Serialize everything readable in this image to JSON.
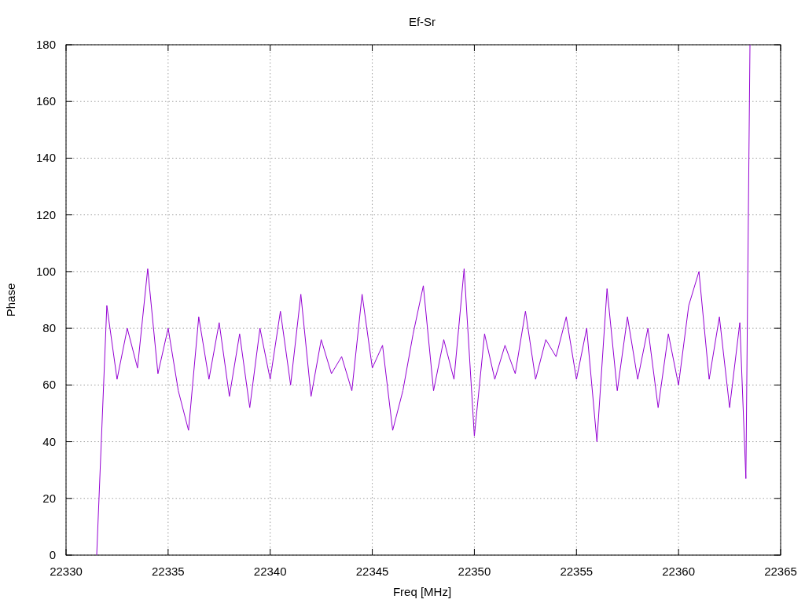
{
  "chart": {
    "chart_data": {
      "type": "line",
      "title": "Ef-Sr",
      "xlabel": "Freq [MHz]",
      "ylabel": "Phase",
      "x": [
        22331.5,
        22332,
        22332.5,
        22333,
        22333.5,
        22334,
        22334.5,
        22335,
        22335.5,
        22336,
        22336.5,
        22337,
        22337.5,
        22338,
        22338.5,
        22339,
        22339.5,
        22340,
        22340.5,
        22341,
        22341.5,
        22342,
        22342.5,
        22343,
        22343.5,
        22344,
        22344.5,
        22345,
        22345.5,
        22346,
        22346.5,
        22347,
        22347.5,
        22348,
        22348.5,
        22349,
        22349.5,
        22350,
        22350.5,
        22351,
        22351.5,
        22352,
        22352.5,
        22353,
        22353.5,
        22354,
        22354.5,
        22355,
        22355.5,
        22356,
        22356.5,
        22357,
        22357.5,
        22358,
        22358.5,
        22359,
        22359.5,
        22360,
        22360.5,
        22361,
        22361.5,
        22362,
        22362.5,
        22363,
        22363.3,
        22363.5
      ],
      "series": [
        {
          "color": "#9400d3",
          "values": [
            0,
            88,
            62,
            80,
            66,
            101,
            64,
            80,
            58,
            44,
            84,
            62,
            82,
            56,
            78,
            52,
            80,
            62,
            86,
            60,
            92,
            56,
            76,
            64,
            70,
            58,
            92,
            66,
            74,
            44,
            58,
            78,
            95,
            58,
            76,
            62,
            101,
            42,
            78,
            62,
            74,
            64,
            86,
            62,
            76,
            70,
            84,
            62,
            80,
            40,
            94,
            58,
            84,
            62,
            80,
            52,
            78,
            60,
            88,
            100,
            62,
            84,
            52,
            82,
            27,
            180
          ]
        }
      ],
      "xlim": [
        22330,
        22365
      ],
      "ylim": [
        0,
        180
      ],
      "grid": true,
      "xticks": [
        22330,
        22335,
        22340,
        22345,
        22350,
        22355,
        22360,
        22365
      ],
      "yticks": [
        0,
        20,
        40,
        60,
        80,
        100,
        120,
        140,
        160,
        180
      ]
    }
  }
}
